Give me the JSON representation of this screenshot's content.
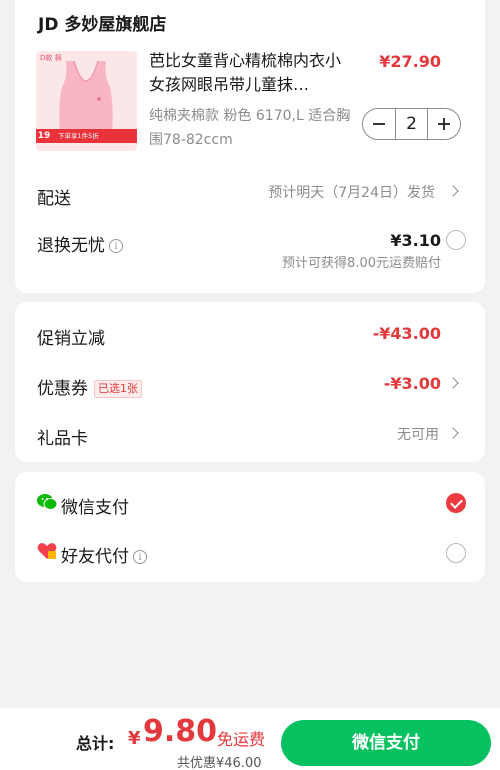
{
  "shop": {
    "name": "JD 多妙屋旗舰店"
  },
  "product": {
    "name": "芭比女童背心精梳棉内衣小女孩网眼吊带儿童抹…",
    "price": "¥27.90",
    "spec": "纯棉夹棉款 粉色 6170,L 适合胸围78-82ccm",
    "quantity": "2",
    "thumb_brand": "D款 棉",
    "thumb_badge_num": "19",
    "thumb_badge_text": "下单享1件5折"
  },
  "delivery": {
    "label": "配送",
    "value": "预计明天（7月24日）发货"
  },
  "return_service": {
    "label": "退换无忧",
    "price": "¥3.10",
    "note": "预计可获得8.00元运费赔付",
    "checked": false
  },
  "promotion": {
    "label": "促销立减",
    "value": "-¥43.00"
  },
  "coupon": {
    "label": "优惠券",
    "badge": "已选1张",
    "value": "-¥3.00"
  },
  "gift_card": {
    "label": "礼品卡",
    "value": "无可用"
  },
  "payment": {
    "wechat": {
      "label": "微信支付",
      "checked": true,
      "icon": "wechat-icon"
    },
    "friend": {
      "label": "好友代付",
      "checked": false,
      "icon": "heart-gift-icon"
    }
  },
  "footer": {
    "total_label": "总计:",
    "currency": "¥",
    "total": "9.80",
    "free_shipping": "免运费",
    "saved": "共优惠¥46.00",
    "pay_button": "微信支付"
  },
  "colors": {
    "accent_red": "#e4393c",
    "wechat_green": "#05c160",
    "background": "#f2f2f2"
  }
}
